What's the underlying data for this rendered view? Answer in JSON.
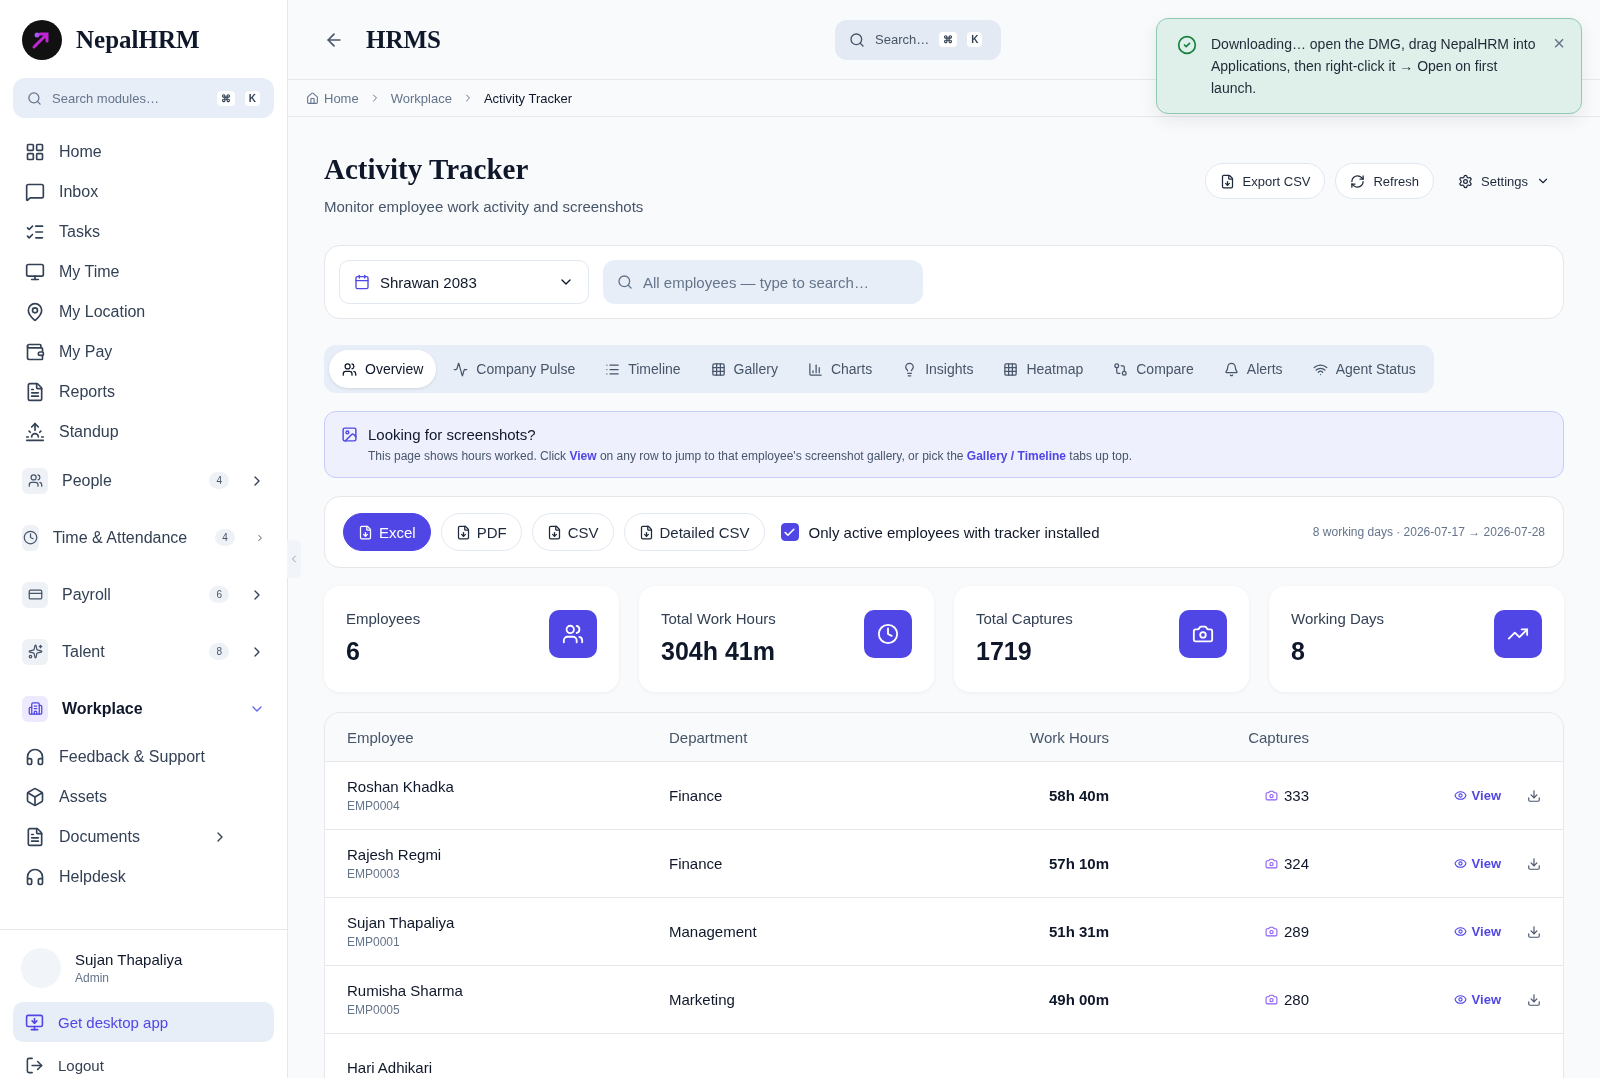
{
  "sidebar": {
    "brand": "NepalHRM",
    "search": {
      "placeholder": "Search modules…",
      "keys": [
        "⌘",
        "K"
      ]
    },
    "items": [
      {
        "kind": "link",
        "label": "Home"
      },
      {
        "kind": "link",
        "label": "Inbox"
      },
      {
        "kind": "link",
        "label": "Tasks"
      },
      {
        "kind": "link",
        "label": "My Time"
      },
      {
        "kind": "link",
        "label": "My Location"
      },
      {
        "kind": "link",
        "label": "My Pay"
      },
      {
        "kind": "link",
        "label": "Reports"
      },
      {
        "kind": "link",
        "label": "Standup"
      },
      {
        "kind": "group",
        "label": "People",
        "badge": "4",
        "expanded": false
      },
      {
        "kind": "group",
        "label": "Time & Attendance",
        "badge": "4",
        "expanded": false
      },
      {
        "kind": "group",
        "label": "Payroll",
        "badge": "6",
        "expanded": false
      },
      {
        "kind": "group",
        "label": "Talent",
        "badge": "8",
        "expanded": false
      },
      {
        "kind": "group",
        "label": "Workplace",
        "expanded": true,
        "children": [
          {
            "label": "Feedback & Support"
          },
          {
            "label": "Assets"
          },
          {
            "label": "Documents",
            "has_submenu": true
          },
          {
            "label": "Helpdesk"
          }
        ]
      }
    ],
    "user": {
      "name": "Sujan Thapaliya",
      "role": "Admin"
    },
    "desktop_app": "Get desktop app",
    "logout": "Logout"
  },
  "header": {
    "title": "HRMS",
    "search": {
      "placeholder": "Search…",
      "keys": [
        "⌘",
        "K"
      ]
    }
  },
  "toast": {
    "message": "Downloading… open the DMG, drag NepalHRM into Applications, then right-click it → Open on first launch.",
    "close": "×"
  },
  "breadcrumbs": [
    "Home",
    "Workplace",
    "Activity Tracker"
  ],
  "page": {
    "title": "Activity Tracker",
    "subtitle": "Monitor employee work activity and screenshots",
    "actions": [
      "Export CSV",
      "Refresh",
      "Settings"
    ]
  },
  "filters": {
    "period": "Shrawan 2083",
    "employee_search": {
      "placeholder": "All employees — type to search…"
    }
  },
  "tabs": [
    {
      "label": "Overview",
      "selected": true
    },
    {
      "label": "Company Pulse",
      "selected": false
    },
    {
      "label": "Timeline",
      "selected": false
    },
    {
      "label": "Gallery",
      "selected": false
    },
    {
      "label": "Charts",
      "selected": false
    },
    {
      "label": "Insights",
      "selected": false
    },
    {
      "label": "Heatmap",
      "selected": false
    },
    {
      "label": "Compare",
      "selected": false
    },
    {
      "label": "Alerts",
      "selected": false
    },
    {
      "label": "Agent Status",
      "selected": false
    }
  ],
  "banner": {
    "title": "Looking for screenshots?",
    "segments": [
      {
        "kind": "text",
        "text": "This page shows hours worked. Click "
      },
      {
        "kind": "link",
        "text": "View"
      },
      {
        "kind": "text",
        "text": " on any row to jump to that employee's screenshot gallery, or pick the "
      },
      {
        "kind": "link",
        "text": "Gallery / Timeline"
      },
      {
        "kind": "text",
        "text": " tabs up top."
      }
    ]
  },
  "export": {
    "buttons": [
      {
        "label": "Excel",
        "selected": true
      },
      {
        "label": "PDF",
        "selected": false
      },
      {
        "label": "CSV",
        "selected": false
      },
      {
        "label": "Detailed CSV",
        "selected": false
      }
    ],
    "active_only": {
      "label": "Only active employees with tracker installed",
      "checked": true
    },
    "range": "8 working days · 2026-07-17 → 2026-07-28"
  },
  "stats": [
    {
      "label": "Employees",
      "value": "6"
    },
    {
      "label": "Total Work Hours",
      "value": "304h 41m"
    },
    {
      "label": "Total Captures",
      "value": "1719"
    },
    {
      "label": "Working Days",
      "value": "8"
    }
  ],
  "table": {
    "columns": [
      "Employee",
      "Department",
      "Work Hours",
      "Captures"
    ],
    "rows": [
      {
        "name": "Roshan Khadka",
        "id": "EMP0004",
        "department": "Finance",
        "hours": "58h 40m",
        "captures": "333",
        "action": "View"
      },
      {
        "name": "Rajesh Regmi",
        "id": "EMP0003",
        "department": "Finance",
        "hours": "57h 10m",
        "captures": "324",
        "action": "View"
      },
      {
        "name": "Sujan Thapaliya",
        "id": "EMP0001",
        "department": "Management",
        "hours": "51h 31m",
        "captures": "289",
        "action": "View"
      },
      {
        "name": "Rumisha Sharma",
        "id": "EMP0005",
        "department": "Marketing",
        "hours": "49h 00m",
        "captures": "280",
        "action": "View"
      },
      {
        "name": "Hari Adhikari"
      }
    ]
  }
}
